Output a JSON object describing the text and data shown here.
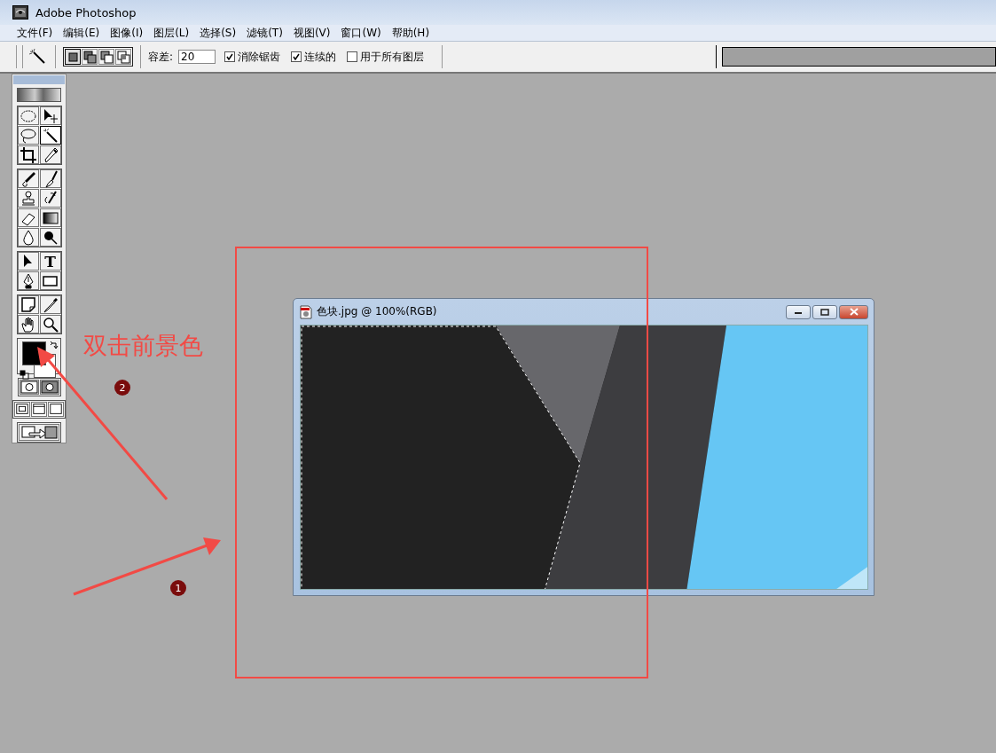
{
  "window": {
    "title": "Adobe Photoshop"
  },
  "menu": [
    {
      "label": "文件(F)"
    },
    {
      "label": "编辑(E)"
    },
    {
      "label": "图像(I)"
    },
    {
      "label": "图层(L)"
    },
    {
      "label": "选择(S)"
    },
    {
      "label": "滤镜(T)"
    },
    {
      "label": "视图(V)"
    },
    {
      "label": "窗口(W)"
    },
    {
      "label": "帮助(H)"
    }
  ],
  "options_bar": {
    "selection_modes": [
      {
        "kind": "new",
        "selected": true
      },
      {
        "kind": "add",
        "selected": false
      },
      {
        "kind": "subtract",
        "selected": false
      },
      {
        "kind": "intersect",
        "selected": false
      }
    ],
    "tolerance_label": "容差:",
    "tolerance_value": "20",
    "checkboxes": [
      {
        "label": "消除锯齿",
        "checked": true
      },
      {
        "label": "连续的",
        "checked": true
      },
      {
        "label": "用于所有图层",
        "checked": false
      }
    ]
  },
  "toolbox": {
    "groups": [
      [
        {
          "kind": "marquee",
          "selected": false
        },
        {
          "kind": "move",
          "selected": false
        },
        {
          "kind": "lasso",
          "selected": false
        },
        {
          "kind": "wand",
          "selected": true
        },
        {
          "kind": "crop",
          "selected": false
        },
        {
          "kind": "slice",
          "selected": false
        }
      ],
      [
        {
          "kind": "airbrush",
          "selected": false
        },
        {
          "kind": "brush",
          "selected": false
        },
        {
          "kind": "stamp",
          "selected": false
        },
        {
          "kind": "history",
          "selected": false
        },
        {
          "kind": "eraser",
          "selected": false
        },
        {
          "kind": "gradient",
          "selected": false
        },
        {
          "kind": "blur",
          "selected": false
        },
        {
          "kind": "dodge",
          "selected": false
        }
      ],
      [
        {
          "kind": "select",
          "selected": false
        },
        {
          "kind": "type",
          "glyph": "T",
          "selected": false
        },
        {
          "kind": "pen",
          "selected": false
        },
        {
          "kind": "shape",
          "selected": false
        }
      ],
      [
        {
          "kind": "notes",
          "selected": false
        },
        {
          "kind": "eyedropper",
          "selected": false
        },
        {
          "kind": "hand",
          "selected": false
        },
        {
          "kind": "zoom",
          "selected": false
        }
      ]
    ],
    "color_swatches": [
      {
        "kind": "foreground",
        "color": "#000000"
      },
      {
        "kind": "background",
        "color": "#ffffff"
      }
    ]
  },
  "document": {
    "title": "色块.jpg @ 100%(RGB)"
  },
  "annotations": {
    "label": "双击前景色",
    "steps": [
      {
        "number": "1"
      },
      {
        "number": "2"
      }
    ]
  }
}
